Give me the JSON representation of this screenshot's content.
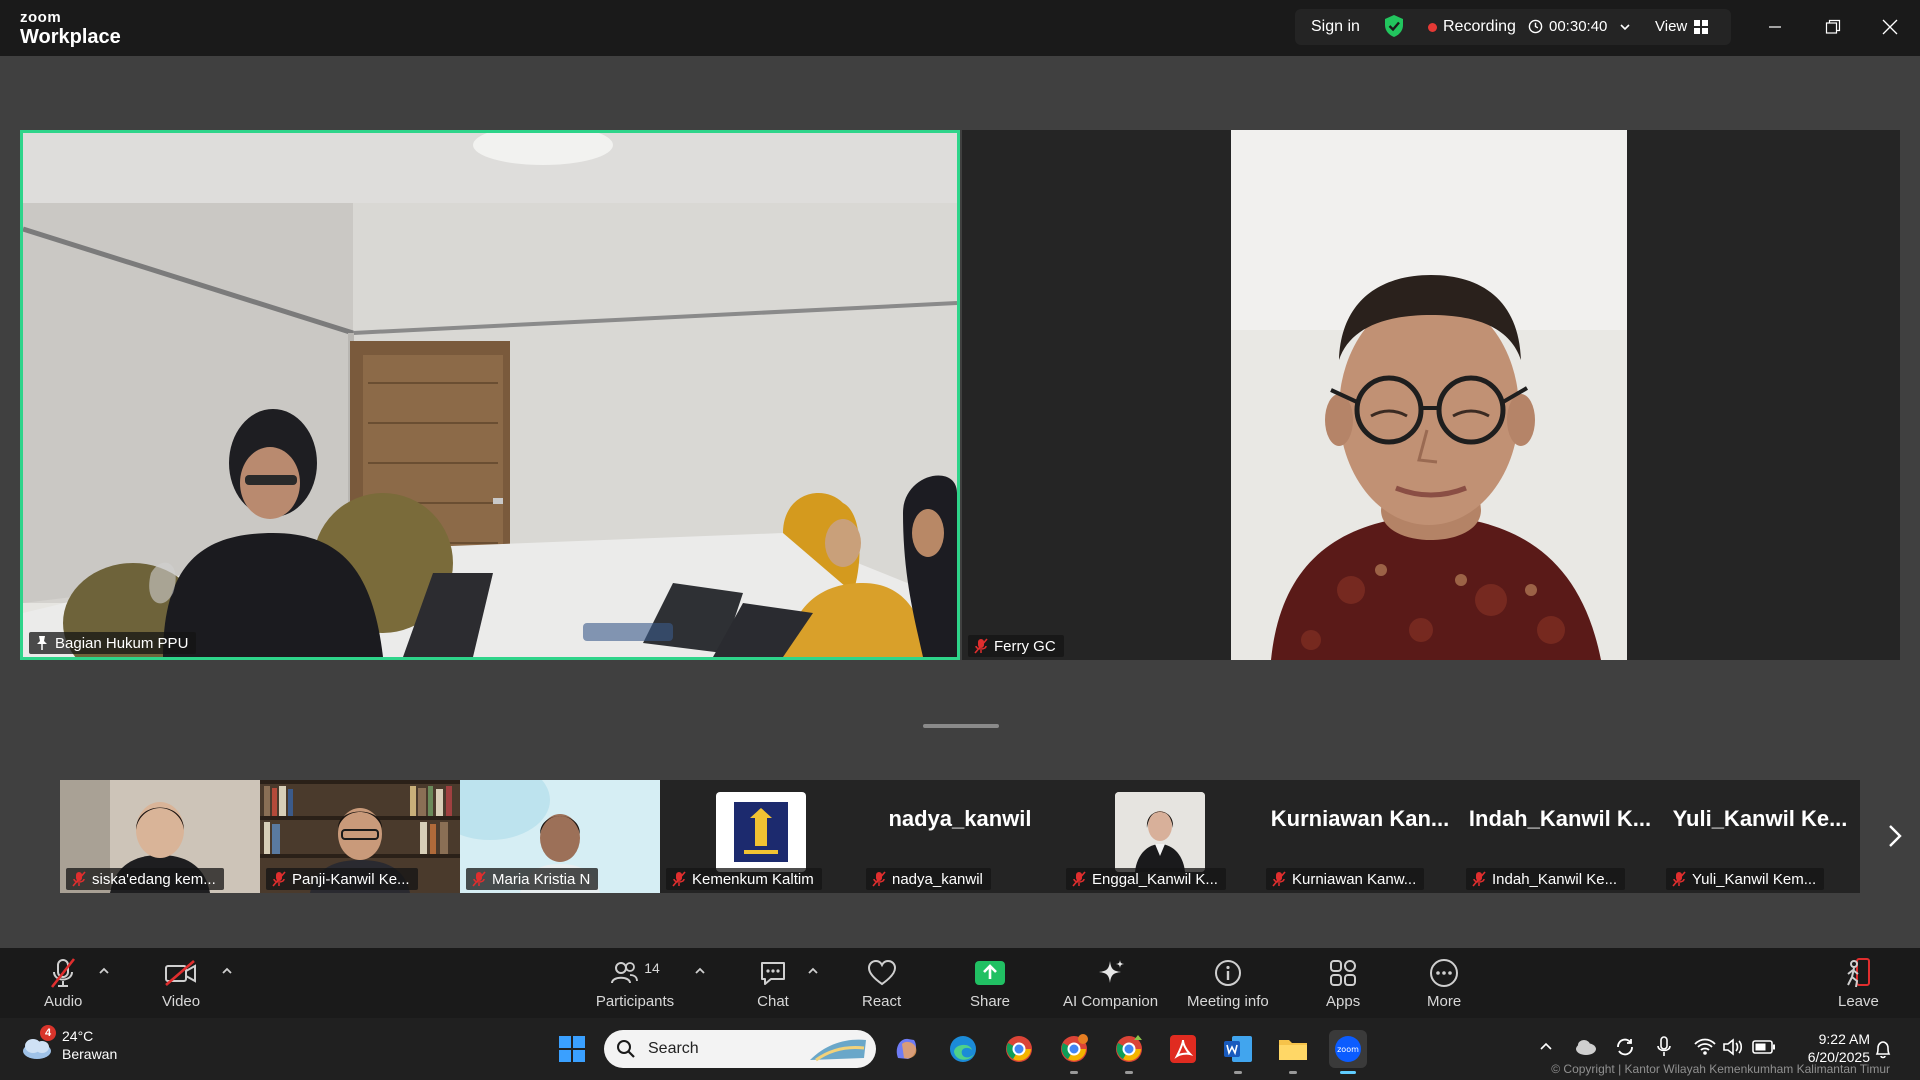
{
  "titlebar": {
    "logo_small": "zoom",
    "logo_big": "Workplace",
    "sign_in": "Sign in",
    "recording": "Recording",
    "timer": "00:30:40",
    "view": "View"
  },
  "main_tiles": [
    {
      "name": "Bagian Hukum PPU",
      "pinned": true
    },
    {
      "name": "Ferry GC",
      "muted": true
    }
  ],
  "strip": [
    {
      "name": "siska'edang kem..."
    },
    {
      "name": "Panji-Kanwil Ke..."
    },
    {
      "name": "Maria Kristia N"
    },
    {
      "name": "Kemenkum Kaltim"
    },
    {
      "name": "nadya_kanwil",
      "display": "nadya_kanwil"
    },
    {
      "name": "Enggal_Kanwil K..."
    },
    {
      "name": "Kurniawan Kanw...",
      "display": "Kurniawan Kan..."
    },
    {
      "name": "Indah_Kanwil Ke...",
      "display": "Indah_Kanwil K..."
    },
    {
      "name": "Yuli_Kanwil Kem...",
      "display": "Yuli_Kanwil Ke..."
    }
  ],
  "toolbar": {
    "audio": "Audio",
    "video": "Video",
    "participants": "Participants",
    "participants_count": "14",
    "chat": "Chat",
    "react": "React",
    "share": "Share",
    "ai_companion": "AI Companion",
    "meeting_info": "Meeting info",
    "apps": "Apps",
    "more": "More",
    "leave": "Leave"
  },
  "taskbar": {
    "weather_temp": "24°C",
    "weather_desc": "Berawan",
    "weather_badge": "4",
    "search": "Search",
    "time": "9:22 AM",
    "date": "6/20/2025",
    "copyright": "© Copyright | Kantor Wilayah Kemenkumham Kalimantan Timur"
  },
  "colors": {
    "active_border": "#2ed48a",
    "recording": "#e53935",
    "shield": "#22c55e",
    "share": "#21c063",
    "mute": "#e02e2e"
  }
}
